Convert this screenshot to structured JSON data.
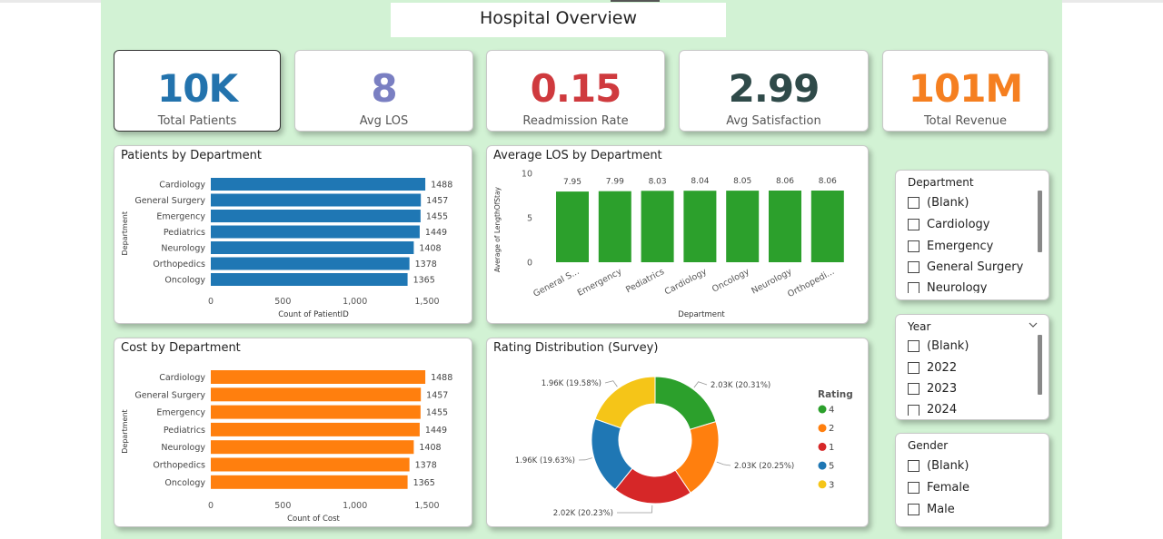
{
  "title": "Hospital Overview",
  "kpis": [
    {
      "value": "10K",
      "label": "Total Patients",
      "color": "#2373ad"
    },
    {
      "value": "8",
      "label": "Avg LOS",
      "color": "#7a7fc2"
    },
    {
      "value": "0.15",
      "label": "Readmission Rate",
      "color": "#cf3a3e"
    },
    {
      "value": "2.99",
      "label": "Avg Satisfaction",
      "color": "#2f4a49"
    },
    {
      "value": "101M",
      "label": "Total Revenue",
      "color": "#f57f20"
    }
  ],
  "patients_chart": {
    "title": "Patients by Department",
    "color": "#1f77b4"
  },
  "los_chart": {
    "title": "Average LOS by Department",
    "color": "#2ca02c"
  },
  "cost_chart": {
    "title": "Cost by Department",
    "color": "#ff7f0e"
  },
  "rating_chart": {
    "title": "Rating Distribution (Survey)",
    "legend_title": "Rating"
  },
  "slicers": {
    "department": {
      "title": "Department",
      "items": [
        "(Blank)",
        "Cardiology",
        "Emergency",
        "General Surgery",
        "Neurology"
      ]
    },
    "year": {
      "title": "Year",
      "items": [
        "(Blank)",
        "2022",
        "2023",
        "2024"
      ]
    },
    "gender": {
      "title": "Gender",
      "items": [
        "(Blank)",
        "Female",
        "Male"
      ]
    }
  },
  "chart_data": [
    {
      "type": "bar",
      "orientation": "horizontal",
      "title": "Patients by Department",
      "categories": [
        "Cardiology",
        "General Surgery",
        "Emergency",
        "Pediatrics",
        "Neurology",
        "Orthopedics",
        "Oncology"
      ],
      "values": [
        1488,
        1457,
        1455,
        1449,
        1408,
        1378,
        1365
      ],
      "xlabel": "Count of PatientID",
      "ylabel": "Department",
      "xlim": [
        0,
        1500
      ],
      "ticks": [
        "0",
        "500",
        "1,000",
        "1,500"
      ]
    },
    {
      "type": "bar",
      "title": "Average LOS by Department",
      "categories": [
        "General S...",
        "Emergency",
        "Pediatrics",
        "Cardiology",
        "Oncology",
        "Neurology",
        "Orthopedi..."
      ],
      "values": [
        7.95,
        7.99,
        8.03,
        8.04,
        8.05,
        8.06,
        8.06
      ],
      "xlabel": "Department",
      "ylabel": "Average of LengthOfStay",
      "ylim": [
        0,
        10
      ],
      "ticks": [
        "0",
        "5",
        "10"
      ]
    },
    {
      "type": "bar",
      "orientation": "horizontal",
      "title": "Cost by Department",
      "categories": [
        "Cardiology",
        "General Surgery",
        "Emergency",
        "Pediatrics",
        "Neurology",
        "Orthopedics",
        "Oncology"
      ],
      "values": [
        1488,
        1457,
        1455,
        1449,
        1408,
        1378,
        1365
      ],
      "xlabel": "Count of Cost",
      "ylabel": "Department",
      "xlim": [
        0,
        1500
      ],
      "ticks": [
        "0",
        "500",
        "1,000",
        "1,500"
      ]
    },
    {
      "type": "pie",
      "subtype": "donut",
      "title": "Rating Distribution (Survey)",
      "legend_title": "Rating",
      "legend_position": "right",
      "slices": [
        {
          "name": "4",
          "value": 2030,
          "label": "2.03K (20.31%)",
          "color": "#2ca02c"
        },
        {
          "name": "2",
          "value": 2030,
          "label": "2.03K (20.25%)",
          "color": "#ff7f0e"
        },
        {
          "name": "1",
          "value": 2020,
          "label": "2.02K (20.23%)",
          "color": "#d62728"
        },
        {
          "name": "5",
          "value": 1960,
          "label": "1.96K (19.63%)",
          "color": "#1f77b4"
        },
        {
          "name": "3",
          "value": 1960,
          "label": "1.96K (19.58%)",
          "color": "#f5c518"
        }
      ]
    }
  ]
}
